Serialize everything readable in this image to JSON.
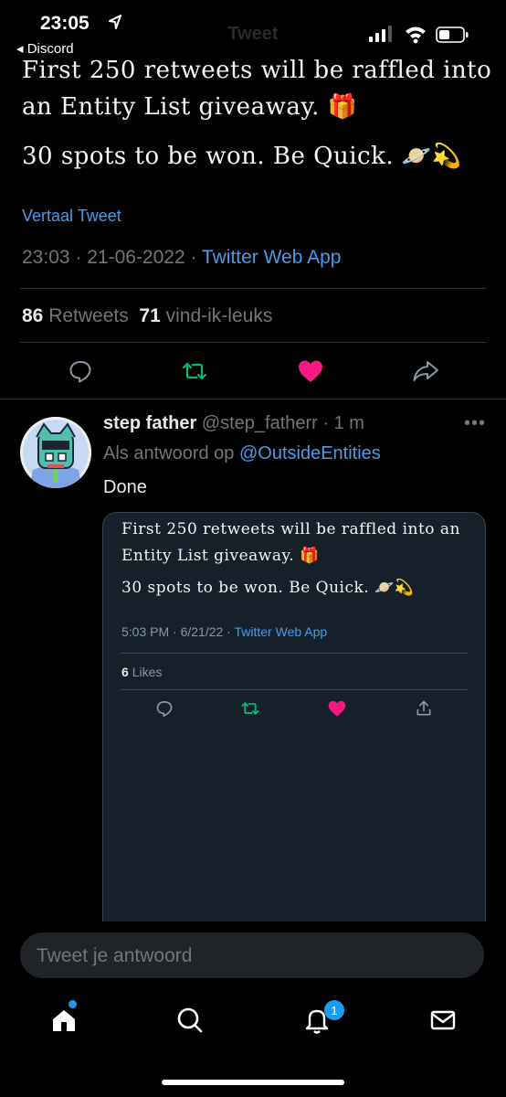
{
  "status_bar": {
    "time": "23:05",
    "back_app": "◂ Discord",
    "title": "Tweet"
  },
  "tweet": {
    "line1": "First 250 retweets will be raffled into",
    "line2": "an Entity List giveaway. 🎁",
    "line3": "30 spots to be won. Be Quick. 🪐💫",
    "translate": "Vertaal Tweet",
    "meta_time": "23:03 · 21-06-2022 · ",
    "meta_app": "Twitter Web App",
    "retweets_count": "86",
    "retweets_label": "Retweets",
    "likes_count": "71",
    "likes_label": "vind-ik-leuks"
  },
  "reply": {
    "name": "step father",
    "handle_time": "@step_fatherr · 1 m",
    "reply_prefix": "Als antwoord op ",
    "reply_handle": "@OutsideEntities",
    "text": "Done",
    "more": "•••"
  },
  "card": {
    "line1": "First 250 retweets will be raffled into an",
    "line2": "Entity List giveaway. 🎁",
    "line3": "30 spots to be won. Be Quick. 🪐💫",
    "meta_time": "5:03 PM · 6/21/22 · ",
    "meta_app": "Twitter Web App",
    "likes_count": "6",
    "likes_label": "Likes"
  },
  "compose": {
    "placeholder": "Tweet je antwoord"
  },
  "tabbar": {
    "notifications_badge": "1"
  },
  "colors": {
    "accent": "#4a9ce8",
    "like": "#f91880",
    "retweet": "#00ba7c",
    "card_bg": "#15202b"
  }
}
